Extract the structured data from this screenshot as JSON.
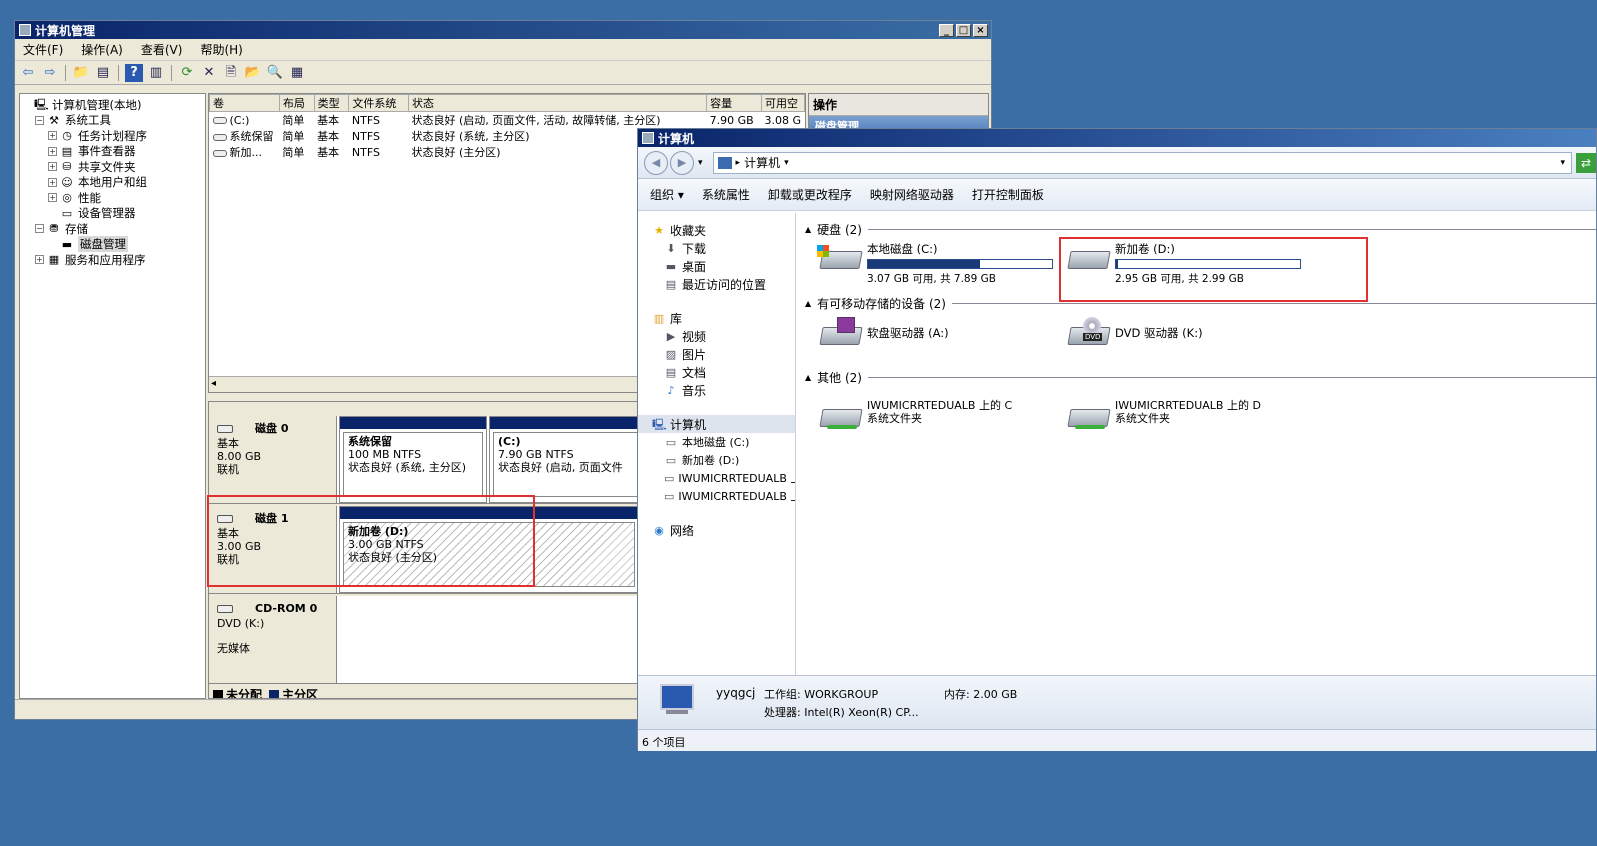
{
  "desktop": {
    "bg": "#3a6ea5"
  },
  "cm": {
    "title": "计算机管理",
    "menu": [
      "文件(F)",
      "操作(A)",
      "查看(V)",
      "帮助(H)"
    ],
    "tree": [
      {
        "label": "计算机管理(本地)",
        "indent": 0,
        "exp": "",
        "icon": "computer-icon"
      },
      {
        "label": "系统工具",
        "indent": 1,
        "exp": "⊟",
        "icon": "tools-icon"
      },
      {
        "label": "任务计划程序",
        "indent": 2,
        "exp": "⊞",
        "icon": "clock-icon"
      },
      {
        "label": "事件查看器",
        "indent": 2,
        "exp": "⊞",
        "icon": "event-icon"
      },
      {
        "label": "共享文件夹",
        "indent": 2,
        "exp": "⊞",
        "icon": "share-icon"
      },
      {
        "label": "本地用户和组",
        "indent": 2,
        "exp": "⊞",
        "icon": "users-icon"
      },
      {
        "label": "性能",
        "indent": 2,
        "exp": "⊞",
        "icon": "performance-icon"
      },
      {
        "label": "设备管理器",
        "indent": 2,
        "exp": "",
        "icon": "device-icon"
      },
      {
        "label": "存储",
        "indent": 1,
        "exp": "⊟",
        "icon": "storage-icon"
      },
      {
        "label": "磁盘管理",
        "indent": 2,
        "exp": "",
        "icon": "disk-icon",
        "selected": true
      },
      {
        "label": "服务和应用程序",
        "indent": 1,
        "exp": "⊞",
        "icon": "services-icon"
      }
    ],
    "columns": [
      "卷",
      "布局",
      "类型",
      "文件系统",
      "状态",
      "容量",
      "可用空"
    ],
    "volumes": [
      [
        "(C:)",
        "简单",
        "基本",
        "NTFS",
        "状态良好 (启动, 页面文件, 活动, 故障转储, 主分区)",
        "7.90 GB",
        "3.08 G"
      ],
      [
        "系统保留",
        "简单",
        "基本",
        "NTFS",
        "状态良好 (系统, 主分区)",
        "",
        ""
      ],
      [
        "新加...",
        "简单",
        "基本",
        "NTFS",
        "状态良好 (主分区)",
        "",
        ""
      ]
    ],
    "actions_title": "操作",
    "actions_sub": "磁盘管理",
    "disks": [
      {
        "name": "磁盘 0",
        "l1": "基本",
        "l2": "8.00 GB",
        "l3": "联机",
        "parts": [
          {
            "title": "系统保留",
            "l1": "100 MB NTFS",
            "l2": "状态良好 (系统, 主分区)"
          },
          {
            "title": "(C:)",
            "l1": "7.90 GB NTFS",
            "l2": "状态良好 (启动, 页面文件"
          }
        ]
      },
      {
        "name": "磁盘 1",
        "l1": "基本",
        "l2": "3.00 GB",
        "l3": "联机",
        "parts": [
          {
            "title": "新加卷 (D:)",
            "l1": "3.00 GB NTFS",
            "l2": "状态良好 (主分区)"
          }
        ]
      },
      {
        "name": "CD-ROM 0",
        "l1": "DVD (K:)",
        "l2": "",
        "l3": "无媒体",
        "parts": []
      }
    ],
    "legend": [
      "未分配",
      "主分区"
    ],
    "colors": {
      "primary": "#0a246a",
      "unallocated": "#000000"
    }
  },
  "exp": {
    "title": "计算机",
    "address": "计算机",
    "commands": [
      "组织 ▾",
      "系统属性",
      "卸载或更改程序",
      "映射网络驱动器",
      "打开控制面板"
    ],
    "nav": [
      {
        "label": "收藏夹",
        "indent": 0,
        "icon": "star-icon"
      },
      {
        "label": "下载",
        "indent": 1,
        "icon": "download-icon"
      },
      {
        "label": "桌面",
        "indent": 1,
        "icon": "desktop-icon"
      },
      {
        "label": "最近访问的位置",
        "indent": 1,
        "icon": "recent-icon"
      },
      {
        "label": "",
        "indent": 0,
        "icon": ""
      },
      {
        "label": "库",
        "indent": 0,
        "icon": "library-icon"
      },
      {
        "label": "视频",
        "indent": 1,
        "icon": "video-icon"
      },
      {
        "label": "图片",
        "indent": 1,
        "icon": "picture-icon"
      },
      {
        "label": "文档",
        "indent": 1,
        "icon": "document-icon"
      },
      {
        "label": "音乐",
        "indent": 1,
        "icon": "music-icon"
      },
      {
        "label": "",
        "indent": 0,
        "icon": ""
      },
      {
        "label": "计算机",
        "indent": 0,
        "icon": "computer-icon",
        "selected": true
      },
      {
        "label": "本地磁盘 (C:)",
        "indent": 1,
        "icon": "drive-icon"
      },
      {
        "label": "新加卷 (D:)",
        "indent": 1,
        "icon": "drive-icon"
      },
      {
        "label": "IWUMICRRTEDUALB 上",
        "indent": 1,
        "icon": "network-drive-icon"
      },
      {
        "label": "IWUMICRRTEDUALB 上",
        "indent": 1,
        "icon": "network-drive-icon"
      },
      {
        "label": "",
        "indent": 0,
        "icon": ""
      },
      {
        "label": "网络",
        "indent": 0,
        "icon": "network-icon"
      }
    ],
    "groups": [
      {
        "label": "硬盘 (2)"
      },
      {
        "label": "有可移动存储的设备 (2)"
      },
      {
        "label": "其他 (2)"
      }
    ],
    "drives": [
      {
        "name": "本地磁盘 (C:)",
        "info": "3.07 GB 可用, 共 7.89 GB",
        "used": 0.61
      },
      {
        "name": "新加卷 (D:)",
        "info": "2.95 GB 可用, 共 2.99 GB",
        "used": 0.013
      }
    ],
    "removable": [
      {
        "name": "软盘驱动器 (A:)"
      },
      {
        "name": "DVD 驱动器 (K:)",
        "badge": "DVD"
      }
    ],
    "other": [
      {
        "l1": "IWUMICRRTEDUALB 上的 C",
        "l2": "系统文件夹"
      },
      {
        "l1": "IWUMICRRTEDUALB 上的 D",
        "l2": "系统文件夹"
      }
    ],
    "details": {
      "name": "yyqgcj",
      "workgroup": "工作组: WORKGROUP",
      "memory": "内存: 2.00 GB",
      "cpu": "处理器: Intel(R) Xeon(R) CP..."
    },
    "status": "6 个项目"
  }
}
